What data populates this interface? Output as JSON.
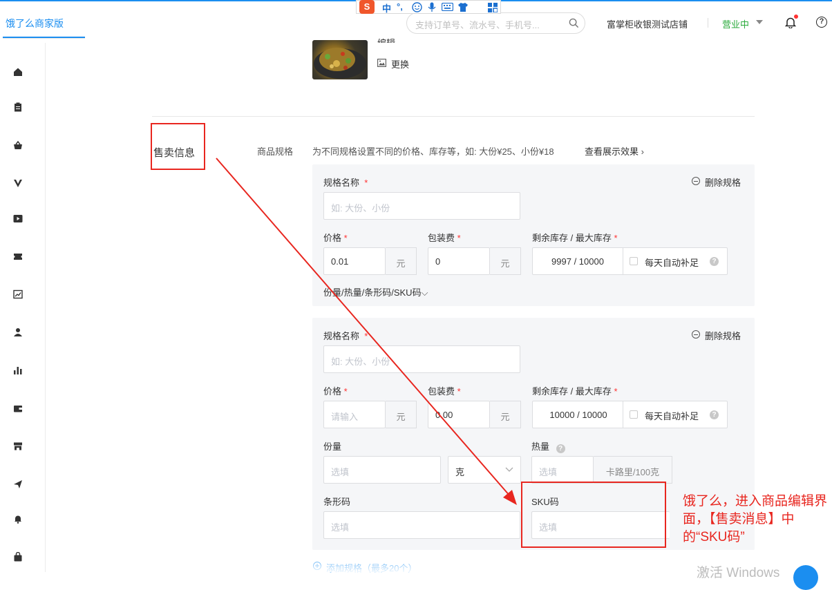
{
  "header": {
    "brand": "饿了么商家版",
    "search_placeholder": "支持订单号、流水号、手机号...",
    "shop_name": "富掌柜收银测试店铺",
    "business_status": "营业中",
    "help_symbol": "?"
  },
  "ime_toolbar": {
    "logo": "S",
    "mode": "中",
    "punct": "°,"
  },
  "sidebar": {
    "icons": [
      "home-icon",
      "clipboard-icon",
      "basket-icon",
      "v-icon",
      "play-icon",
      "ticket-icon",
      "chart-line-icon",
      "user-icon",
      "bar-chart-icon",
      "wallet-icon",
      "store-icon",
      "send-icon",
      "bell-icon",
      "bag-icon"
    ]
  },
  "image_section": {
    "edit_label": "编辑",
    "replace_label": "更换"
  },
  "sell_info": {
    "section_title": "售卖信息",
    "spec_label": "商品规格",
    "spec_hint": "为不同规格设置不同的价格、库存等，如: 大份¥25、小份¥18",
    "preview_link": "查看展示效果",
    "specs": [
      {
        "name_label": "规格名称",
        "name_placeholder": "如: 大份、小份",
        "delete_label": "删除规格",
        "price_label": "价格",
        "price_value": "0.01",
        "price_unit": "元",
        "pack_label": "包装费",
        "pack_value": "0",
        "pack_unit": "元",
        "stock_label": "剩余库存 / 最大库存",
        "stock_value": "9997 / 10000",
        "auto_refill_label": "每天自动补足",
        "more_toggle": "份量/热量/条形码/SKU码"
      },
      {
        "name_label": "规格名称",
        "name_placeholder": "如: 大份、小份",
        "delete_label": "删除规格",
        "price_label": "价格",
        "price_placeholder": "请输入",
        "price_unit": "元",
        "pack_label": "包装费",
        "pack_value": "0.00",
        "pack_unit": "元",
        "stock_label": "剩余库存 / 最大库存",
        "stock_value": "10000 / 10000",
        "auto_refill_label": "每天自动补足",
        "portion_label": "份量",
        "portion_placeholder": "选填",
        "portion_unit": "克",
        "calorie_label": "热量",
        "calorie_placeholder": "选填",
        "calorie_unit": "卡路里/100克",
        "barcode_label": "条形码",
        "barcode_placeholder": "选填",
        "sku_label": "SKU码",
        "sku_placeholder": "选填"
      }
    ],
    "add_spec": "添加规格（最多20个）"
  },
  "annotation": {
    "text": "饿了么，进入商品编辑界面，【售卖消息】中的“SKU码”"
  },
  "overlay": {
    "watermark": "激活 Windows"
  },
  "colors": {
    "accent": "#1b8ef0",
    "open_status": "#2aaa3b",
    "annotation_red": "#e8261f",
    "panel_bg": "#f5f6f8"
  }
}
